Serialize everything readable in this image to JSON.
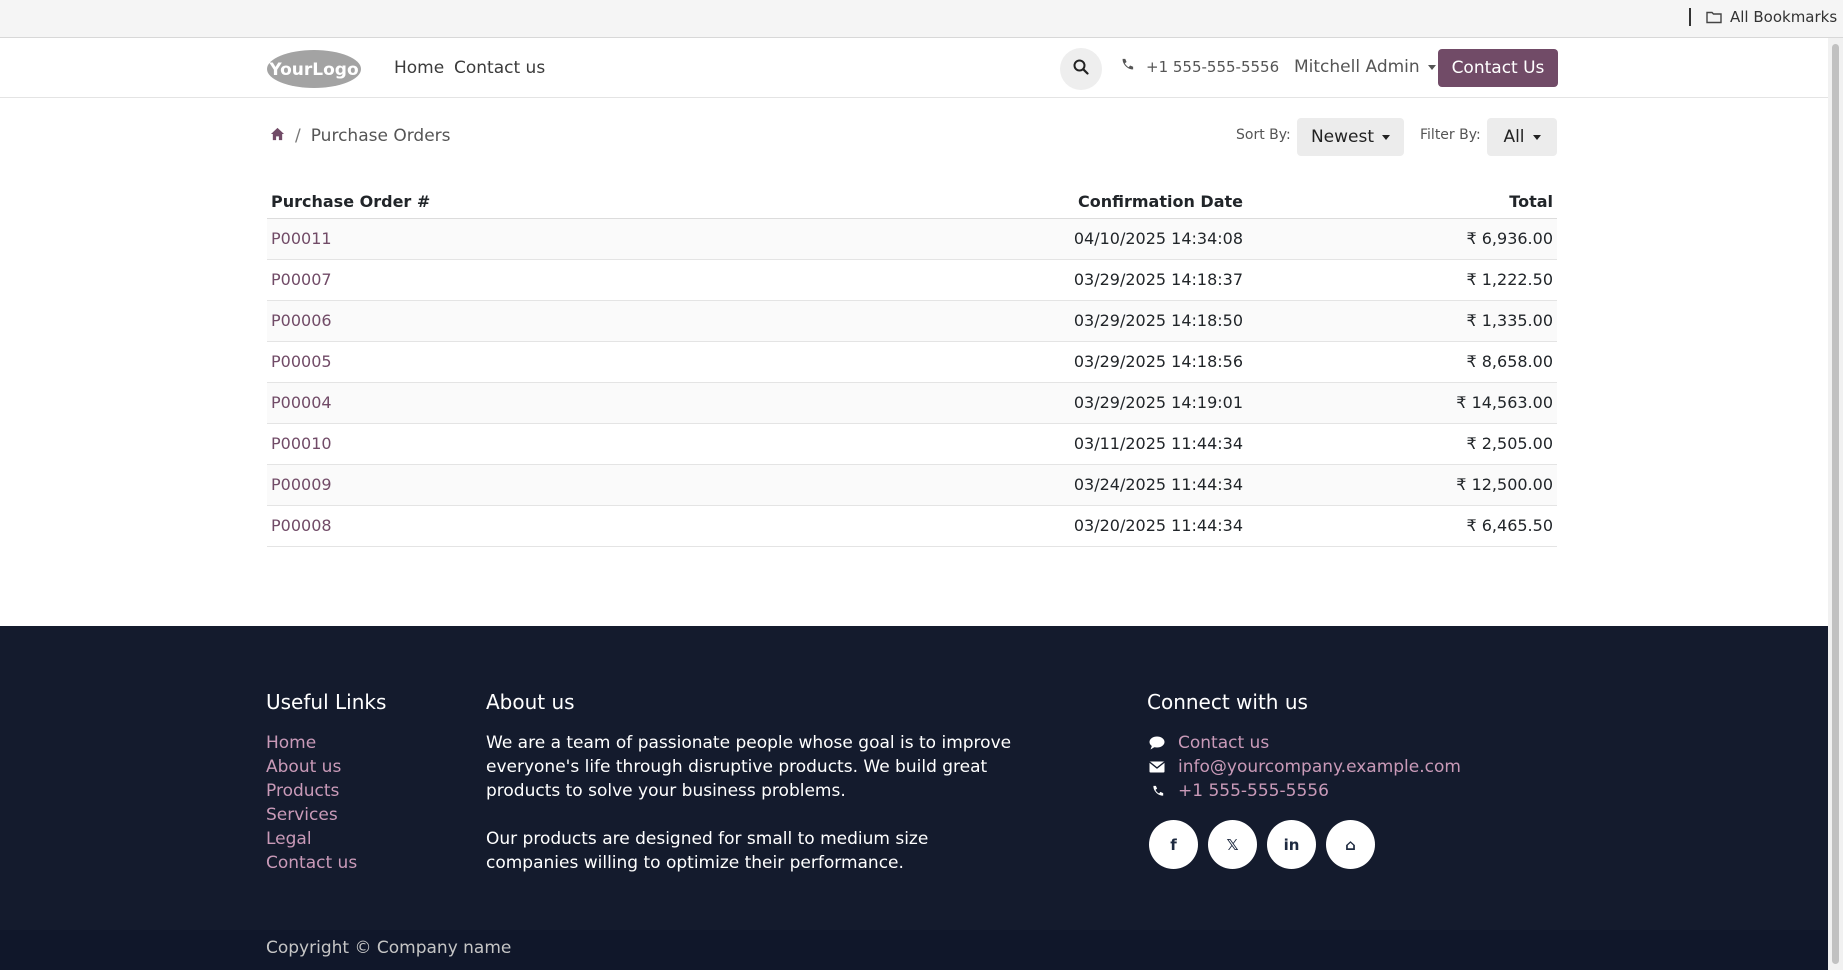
{
  "bookmarks": {
    "all_label": "All Bookmarks"
  },
  "header": {
    "logo_text": "YourLogo",
    "nav": [
      {
        "label": "Home"
      },
      {
        "label": "Contact us"
      }
    ],
    "phone": "+1 555-555-5556",
    "user": "Mitchell Admin",
    "cta_label": "Contact Us"
  },
  "breadcrumb": {
    "current": "Purchase Orders"
  },
  "sort": {
    "label": "Sort By:",
    "value": "Newest"
  },
  "filter": {
    "label": "Filter By:",
    "value": "All"
  },
  "table": {
    "headers": {
      "order": "Purchase Order #",
      "date": "Confirmation Date",
      "total": "Total"
    },
    "rows": [
      {
        "order": "P00011",
        "date": "04/10/2025  14:34:08",
        "total": "₹ 6,936.00"
      },
      {
        "order": "P00007",
        "date": "03/29/2025  14:18:37",
        "total": "₹ 1,222.50"
      },
      {
        "order": "P00006",
        "date": "03/29/2025  14:18:50",
        "total": "₹ 1,335.00"
      },
      {
        "order": "P00005",
        "date": "03/29/2025  14:18:56",
        "total": "₹ 8,658.00"
      },
      {
        "order": "P00004",
        "date": "03/29/2025  14:19:01",
        "total": "₹ 14,563.00"
      },
      {
        "order": "P00010",
        "date": "03/11/2025  11:44:34",
        "total": "₹ 2,505.00"
      },
      {
        "order": "P00009",
        "date": "03/24/2025  11:44:34",
        "total": "₹ 12,500.00"
      },
      {
        "order": "P00008",
        "date": "03/20/2025  11:44:34",
        "total": "₹ 6,465.50"
      }
    ]
  },
  "footer": {
    "useful_links": {
      "title": "Useful Links",
      "items": [
        "Home",
        "About us",
        "Products",
        "Services",
        "Legal",
        "Contact us"
      ]
    },
    "about": {
      "title": "About us",
      "p1": "We are a team of passionate people whose goal is to improve everyone's life through disruptive products. We build great products to solve your business problems.",
      "p2": "Our products are designed for small to medium size companies willing to optimize their performance."
    },
    "connect": {
      "title": "Connect with us",
      "contact": "Contact us",
      "email": "info@yourcompany.example.com",
      "phone": "+1 555-555-5556"
    },
    "socials": [
      {
        "icon": "facebook-icon",
        "glyph": "f"
      },
      {
        "icon": "x-twitter-icon",
        "glyph": "𝕏"
      },
      {
        "icon": "linkedin-icon",
        "glyph": "in"
      },
      {
        "icon": "home-icon",
        "glyph": "⌂"
      }
    ],
    "copyright": "Copyright © Company name"
  },
  "colors": {
    "brand": "#714B67",
    "footer_bg": "#141b2d",
    "footer_link": "#c99ab8"
  }
}
